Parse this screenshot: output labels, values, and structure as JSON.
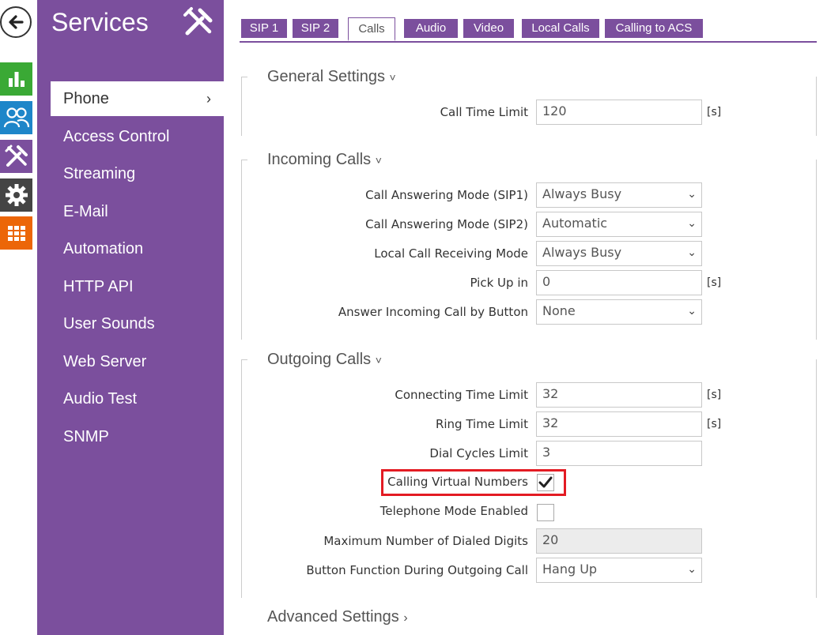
{
  "sidebar": {
    "title": "Services",
    "items": [
      {
        "label": "Phone",
        "active": true
      },
      {
        "label": "Access Control"
      },
      {
        "label": "Streaming"
      },
      {
        "label": "E-Mail"
      },
      {
        "label": "Automation"
      },
      {
        "label": "HTTP API"
      },
      {
        "label": "User Sounds"
      },
      {
        "label": "Web Server"
      },
      {
        "label": "Audio Test"
      },
      {
        "label": "SNMP"
      }
    ]
  },
  "rail": {
    "icons": [
      "back-arrow-icon",
      "bar-chart-icon",
      "users-icon",
      "tools-icon",
      "gear-icon",
      "grid-icon"
    ],
    "colors": {
      "status": "#3aa935",
      "directory": "#1e86c9",
      "services": "#7b4f9d",
      "system": "#444444",
      "hardware": "#ec6608"
    }
  },
  "tabs": [
    {
      "label": "SIP 1"
    },
    {
      "label": "SIP 2"
    },
    {
      "label": "Calls",
      "active": true
    },
    {
      "label": "Audio"
    },
    {
      "label": "Video"
    },
    {
      "label": "Local Calls"
    },
    {
      "label": "Calling to ACS"
    }
  ],
  "general": {
    "title": "General Settings",
    "call_time_limit": {
      "label": "Call Time Limit",
      "value": "120",
      "unit": "[s]"
    }
  },
  "incoming": {
    "title": "Incoming Calls",
    "answer_mode_sip1": {
      "label": "Call Answering Mode (SIP1)",
      "value": "Always Busy"
    },
    "answer_mode_sip2": {
      "label": "Call Answering Mode (SIP2)",
      "value": "Automatic"
    },
    "local_receiving_mode": {
      "label": "Local Call Receiving Mode",
      "value": "Always Busy"
    },
    "pick_up_in": {
      "label": "Pick Up in",
      "value": "0",
      "unit": "[s]"
    },
    "answer_by_button": {
      "label": "Answer Incoming Call by Button",
      "value": "None"
    }
  },
  "outgoing": {
    "title": "Outgoing Calls",
    "connecting_time_limit": {
      "label": "Connecting Time Limit",
      "value": "32",
      "unit": "[s]"
    },
    "ring_time_limit": {
      "label": "Ring Time Limit",
      "value": "32",
      "unit": "[s]"
    },
    "dial_cycles_limit": {
      "label": "Dial Cycles Limit",
      "value": "3"
    },
    "calling_virtual_numbers": {
      "label": "Calling Virtual Numbers",
      "checked": true
    },
    "telephone_mode_enabled": {
      "label": "Telephone Mode Enabled",
      "checked": false
    },
    "max_dialed_digits": {
      "label": "Maximum Number of Dialed Digits",
      "value": "20"
    },
    "button_function": {
      "label": "Button Function During Outgoing Call",
      "value": "Hang Up"
    }
  },
  "advanced": {
    "title": "Advanced Settings"
  },
  "accent": "#7b4f9d",
  "highlight_color": "#e31b23"
}
